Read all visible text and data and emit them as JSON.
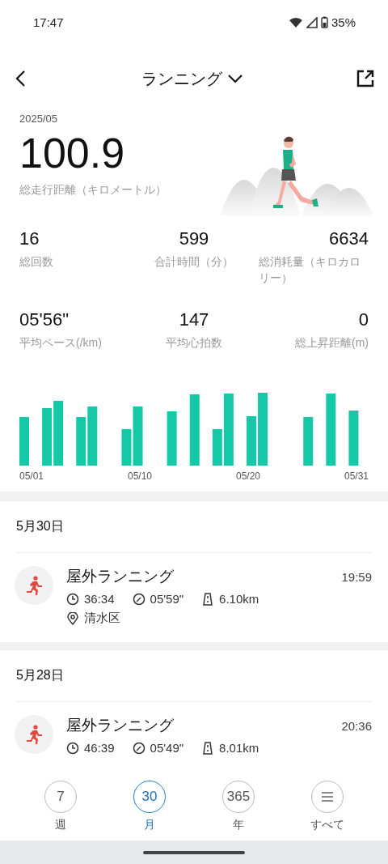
{
  "status_bar": {
    "time": "17:47",
    "battery": "35%"
  },
  "header": {
    "title": "ランニング"
  },
  "summary": {
    "period": "2025/05",
    "total": "100.9",
    "total_label": "総走行距離（キロメートル）"
  },
  "stats": [
    {
      "value": "16",
      "label": "総回数"
    },
    {
      "value": "599",
      "label": "合計時間（分）"
    },
    {
      "value": "6634",
      "label": "総消耗量（キロカロリー）"
    },
    {
      "value": "05'56\"",
      "label": "平均ペース(/km)"
    },
    {
      "value": "147",
      "label": "平均心拍数"
    },
    {
      "value": "0",
      "label": "総上昇距離(m)"
    }
  ],
  "chart": {
    "axis_labels": [
      "05/01",
      "05/10",
      "05/20",
      "05/31"
    ]
  },
  "days": [
    {
      "date": "5月30日",
      "records": [
        {
          "title": "屋外ランニング",
          "time": "19:59",
          "duration": "36:34",
          "pace": "05'59\"",
          "distance": "6.10km",
          "place": "清水区"
        }
      ]
    },
    {
      "date": "5月28日",
      "records": [
        {
          "title": "屋外ランニング",
          "time": "20:36",
          "duration": "46:39",
          "pace": "05'49\"",
          "distance": "8.01km"
        }
      ]
    }
  ],
  "bottom_tabs": [
    {
      "kind": "number",
      "icon_text": "7",
      "label": "週",
      "selected": false
    },
    {
      "kind": "number",
      "icon_text": "30",
      "label": "月",
      "selected": true
    },
    {
      "kind": "number",
      "icon_text": "365",
      "label": "年",
      "selected": false
    },
    {
      "kind": "menu",
      "label": "すべて",
      "selected": false
    }
  ]
}
